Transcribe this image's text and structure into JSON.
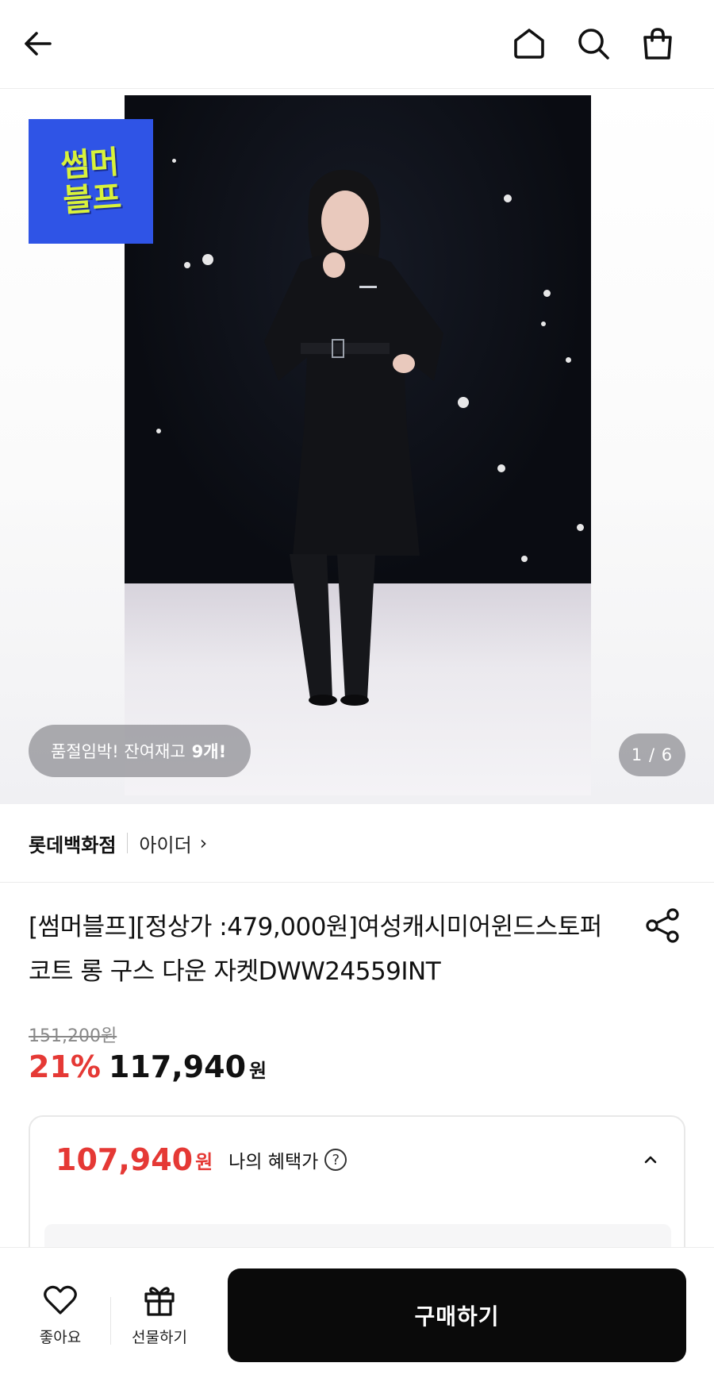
{
  "header": {
    "back_icon": "arrow-left-icon",
    "home_icon": "home-icon",
    "search_icon": "search-icon",
    "cart_icon": "shopping-bag-icon"
  },
  "gallery": {
    "promo_badge": "썸머\n블프",
    "stock_prefix": "품절임박! 잔여재고",
    "stock_count": "9개!",
    "counter": "1 / 6",
    "photo_alt": "product-photo",
    "colors": {
      "badge_bg": "#2f54e6",
      "badge_text": "#d8f23a"
    }
  },
  "brand": {
    "store": "롯데백화점",
    "name": "아이더",
    "chevron": "›"
  },
  "product": {
    "title": "[썸머블프][정상가 :479,000원]여성캐시미어윈드스토퍼코트 롱 구스 다운 자켓DWW24559INT",
    "share_icon": "share-icon"
  },
  "pricing": {
    "original_price": "151,200원",
    "discount_rate": "21%",
    "sale_price": "117,940",
    "currency": "원",
    "accent_color": "#e53935"
  },
  "benefit": {
    "price": "107,940",
    "currency": "원",
    "label": "나의 혜택가",
    "help_symbol": "?",
    "chevron": "up"
  },
  "bottom_bar": {
    "like_label": "좋아요",
    "gift_label": "선물하기",
    "buy_label": "구매하기"
  }
}
